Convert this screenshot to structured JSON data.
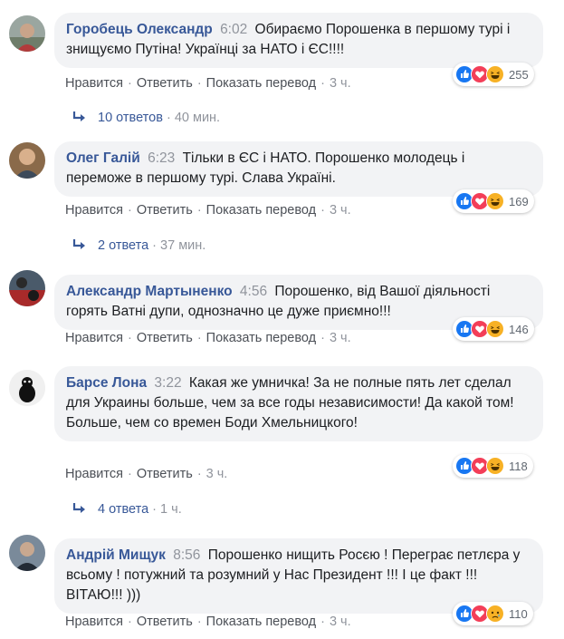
{
  "action_labels": {
    "like": "Нравится",
    "reply": "Ответить",
    "translate": "Показать перевод"
  },
  "comments": [
    {
      "author": "Горобець Олександр",
      "time": "6:02",
      "text": "Обираємо Порошенка в першому турі і знищуємо Путіна! Українці за НАТО і ЄС!!!!",
      "reactions": [
        "like",
        "love",
        "haha"
      ],
      "reaction_count": "255",
      "ago": "3 ч.",
      "replies": {
        "count_label": "10 ответов",
        "ago": "40 мин."
      }
    },
    {
      "author": "Олег Галій",
      "time": "6:23",
      "text": "Тільки в ЄС і НАТО. Порошенко молодець і переможе в першому турі. Слава Україні.",
      "reactions": [
        "like",
        "love",
        "haha"
      ],
      "reaction_count": "169",
      "ago": "3 ч.",
      "replies": {
        "count_label": "2 ответа",
        "ago": "37 мин."
      }
    },
    {
      "author": "Александр Мартыненко",
      "time": "4:56",
      "text": "Порошенко, від Вашої діяльності горять Ватні дупи, однозначно це дуже приємно!!!",
      "reactions": [
        "like",
        "love",
        "haha"
      ],
      "reaction_count": "146",
      "ago": "3 ч."
    },
    {
      "author": "Барсе Лона",
      "time": "3:22",
      "text": "Какая же умничка! За не полные пять лет сделал для Украины больше, чем за все годы независимости! Да какой том! Больше, чем со времен Боди Хмельницкого!",
      "reactions": [
        "like",
        "love",
        "haha"
      ],
      "reaction_count": "118",
      "ago": "3 ч.",
      "replies": {
        "count_label": "4 ответа",
        "ago": "1 ч."
      }
    },
    {
      "author": "Андрій Мищук",
      "time": "8:56",
      "text": "Порошенко нищить Росєю ! Перегрaє петлєра у всьому ! потужний та розумний у Нас Президент !!! І це факт !!! ВІТАЮ!!! )))",
      "reactions": [
        "like",
        "love",
        "sad"
      ],
      "reaction_count": "110",
      "ago": "3 ч."
    }
  ],
  "colors": {
    "link": "#385898",
    "bubble": "#f2f3f5",
    "like": "#1877f2",
    "love": "#f33e58",
    "haha": "#f7b125"
  }
}
